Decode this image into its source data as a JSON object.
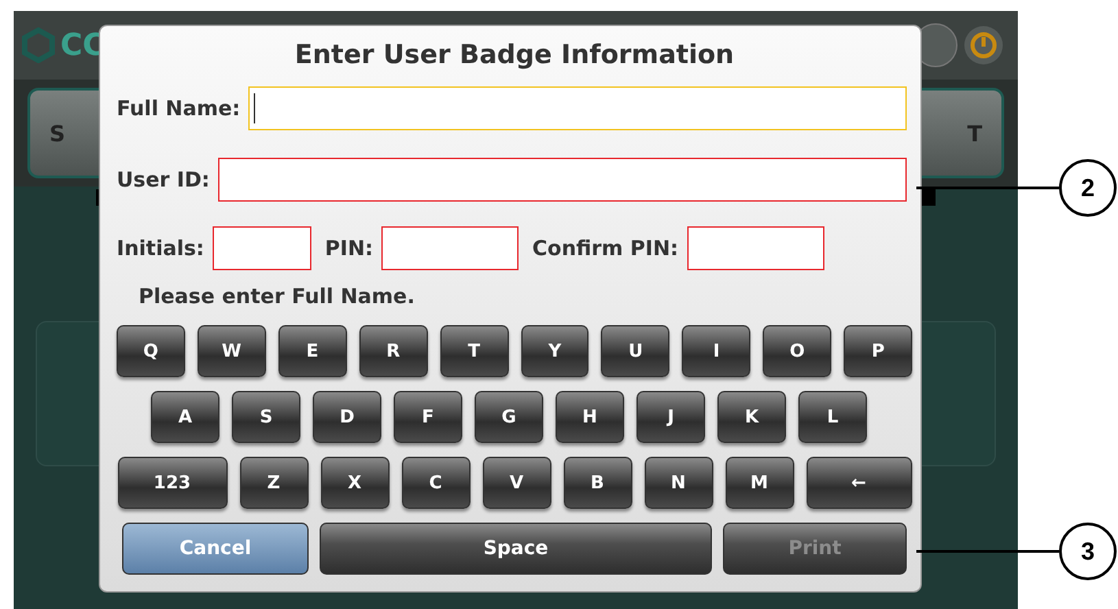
{
  "background_app": {
    "logo_text": "CC",
    "left_button": "S",
    "right_button": "T"
  },
  "dialog": {
    "title": "Enter User Badge Information",
    "fields": [
      {
        "label": "Full Name:",
        "focused": true,
        "invalid": false
      },
      {
        "label": "User ID:",
        "focused": false,
        "invalid": true
      },
      {
        "label": "Initials:",
        "focused": false,
        "invalid": true
      },
      {
        "label": "PIN:",
        "focused": false,
        "invalid": true
      },
      {
        "label": "Confirm PIN:",
        "focused": false,
        "invalid": true
      }
    ],
    "message": "Please enter Full Name.",
    "keyboard": [
      [
        "Q",
        "W",
        "E",
        "R",
        "T",
        "Y",
        "U",
        "I",
        "O",
        "P"
      ],
      [
        "A",
        "S",
        "D",
        "F",
        "G",
        "H",
        "J",
        "K",
        "L"
      ],
      [
        "123",
        "Z",
        "X",
        "C",
        "V",
        "B",
        "N",
        "M",
        "←"
      ]
    ],
    "actions": [
      {
        "label": "Cancel",
        "kind": "cancel",
        "disabled": false
      },
      {
        "label": "Space",
        "kind": "space",
        "disabled": false
      },
      {
        "label": "Print",
        "kind": "print",
        "disabled": true
      }
    ]
  },
  "callouts": [
    "2",
    "3"
  ]
}
